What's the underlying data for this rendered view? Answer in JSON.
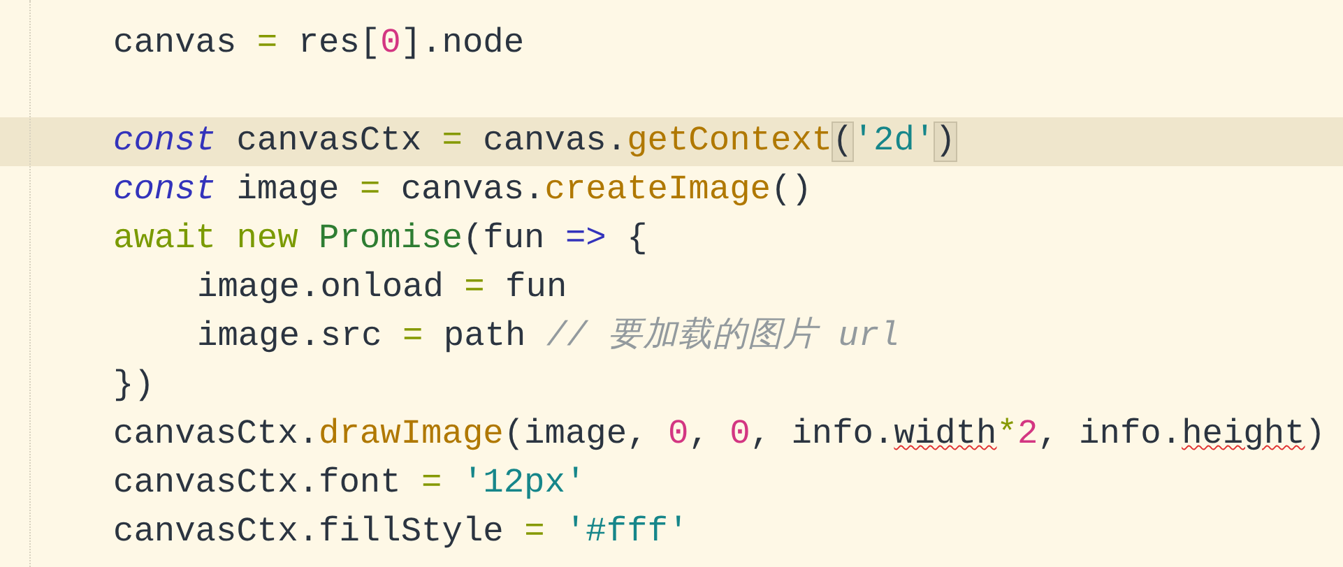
{
  "lines": [
    {
      "current": false,
      "tokens": [
        {
          "text": "canvas ",
          "kind": "plain"
        },
        {
          "text": "=",
          "kind": "operator"
        },
        {
          "text": " res[",
          "kind": "plain"
        },
        {
          "text": "0",
          "kind": "number"
        },
        {
          "text": "].node",
          "kind": "plain"
        }
      ]
    },
    {
      "current": false
    },
    {
      "current": true,
      "tokens": [
        {
          "text": "const",
          "kind": "keyword"
        },
        {
          "text": " canvasCtx ",
          "kind": "plain"
        },
        {
          "text": "=",
          "kind": "operator"
        },
        {
          "text": " canvas.",
          "kind": "plain"
        },
        {
          "text": "getContext",
          "kind": "method"
        },
        {
          "text": "(",
          "kind": "bracket-match"
        },
        {
          "text": "'2d'",
          "kind": "string"
        },
        {
          "text": ")",
          "kind": "bracket-match"
        }
      ]
    },
    {
      "current": false,
      "tokens": [
        {
          "text": "const",
          "kind": "keyword"
        },
        {
          "text": " image ",
          "kind": "plain"
        },
        {
          "text": "=",
          "kind": "operator"
        },
        {
          "text": " canvas.",
          "kind": "plain"
        },
        {
          "text": "createImage",
          "kind": "method"
        },
        {
          "text": "()",
          "kind": "plain"
        }
      ]
    },
    {
      "current": false,
      "tokens": [
        {
          "text": "await new ",
          "kind": "control"
        },
        {
          "text": "Promise",
          "kind": "class"
        },
        {
          "text": "(fun ",
          "kind": "plain"
        },
        {
          "text": "=>",
          "kind": "arrow"
        },
        {
          "text": " {",
          "kind": "plain"
        }
      ],
      "children": [
        {
          "current": false,
          "tokens": [
            {
              "text": "image.onload ",
              "kind": "plain"
            },
            {
              "text": "=",
              "kind": "operator"
            },
            {
              "text": " fun",
              "kind": "plain"
            }
          ]
        },
        {
          "current": false,
          "tokens": [
            {
              "text": "image.src ",
              "kind": "plain"
            },
            {
              "text": "=",
              "kind": "operator"
            },
            {
              "text": " path ",
              "kind": "plain"
            },
            {
              "text": "// 要加载的图片 url",
              "kind": "comment"
            }
          ]
        }
      ]
    },
    {
      "current": false,
      "tokens": [
        {
          "text": "})",
          "kind": "plain"
        }
      ]
    },
    {
      "current": false,
      "tokens": [
        {
          "text": "canvasCtx.",
          "kind": "plain"
        },
        {
          "text": "drawImage",
          "kind": "method"
        },
        {
          "text": "(image, ",
          "kind": "plain"
        },
        {
          "text": "0",
          "kind": "number"
        },
        {
          "text": ", ",
          "kind": "plain"
        },
        {
          "text": "0",
          "kind": "number"
        },
        {
          "text": ", info.",
          "kind": "plain"
        },
        {
          "text": "width",
          "kind": "typo"
        },
        {
          "text": "*",
          "kind": "operator"
        },
        {
          "text": "2",
          "kind": "number"
        },
        {
          "text": ", info.",
          "kind": "plain"
        },
        {
          "text": "height",
          "kind": "typo"
        },
        {
          "text": ")",
          "kind": "plain"
        }
      ]
    },
    {
      "current": false,
      "tokens": [
        {
          "text": "canvasCtx.font ",
          "kind": "plain"
        },
        {
          "text": "= ",
          "kind": "operator"
        },
        {
          "text": "'12px'",
          "kind": "string"
        }
      ]
    },
    {
      "current": false,
      "tokens": [
        {
          "text": "canvasCtx.fillStyle ",
          "kind": "plain"
        },
        {
          "text": "= ",
          "kind": "operator"
        },
        {
          "text": "'#fff'",
          "kind": "string"
        }
      ]
    }
  ]
}
